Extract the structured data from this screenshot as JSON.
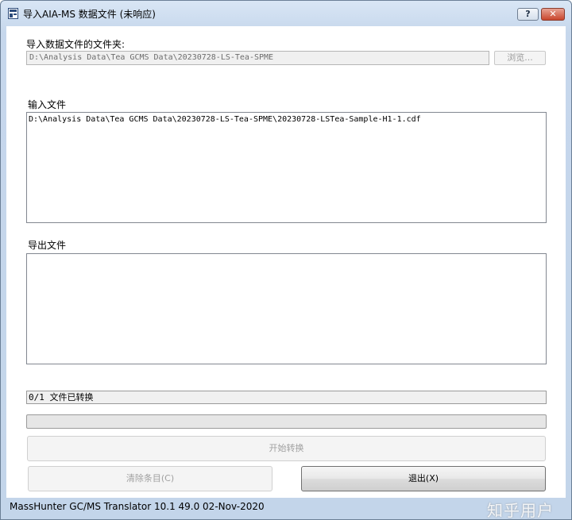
{
  "window": {
    "title": "导入AIA-MS 数据文件 (未响应)",
    "help_label": "?",
    "close_label": "✕"
  },
  "folder": {
    "label": "导入数据文件的文件夹:",
    "value": "D:\\Analysis Data\\Tea GCMS Data\\20230728-LS-Tea-SPME",
    "browse_label": "浏览..."
  },
  "input_files": {
    "label": "输入文件",
    "items": [
      "D:\\Analysis Data\\Tea GCMS Data\\20230728-LS-Tea-SPME\\20230728-LSTea-Sample-H1-1.cdf"
    ]
  },
  "output_files": {
    "label": "导出文件",
    "items": []
  },
  "status": {
    "text": "0/1 文件已转换",
    "progress_percent": 0
  },
  "buttons": {
    "start_label": "开始转换",
    "clear_label": "清除条目(C)",
    "exit_label": "退出(X)"
  },
  "footer": {
    "version_text": "MassHunter GC/MS Translator 10.1 49.0 02-Nov-2020",
    "watermark": "知乎用户"
  },
  "colors": {
    "progress_fill": "#3cb43c",
    "close_button": "#c9452c"
  }
}
